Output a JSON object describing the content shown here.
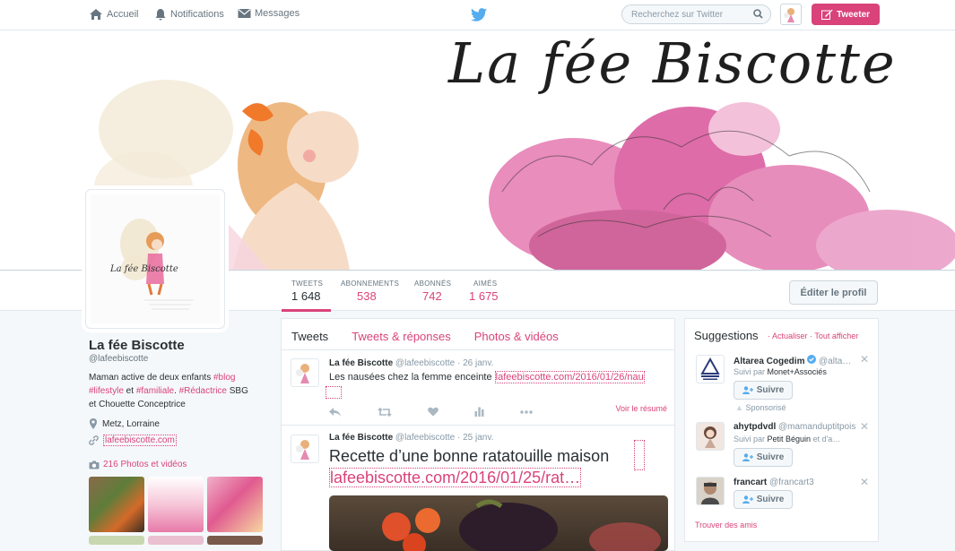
{
  "nav": {
    "home": "Accueil",
    "notifications": "Notifications",
    "messages": "Messages"
  },
  "search": {
    "placeholder": "Recherchez sur Twitter"
  },
  "tweet_button": "Tweeter",
  "banner": {
    "title": "La fée Biscotte"
  },
  "profile_pic": {
    "title": "La fée Biscotte"
  },
  "stats": [
    {
      "label": "TWEETS",
      "value": "1 648"
    },
    {
      "label": "ABONNEMENTS",
      "value": "538"
    },
    {
      "label": "ABONNÉS",
      "value": "742"
    },
    {
      "label": "AIMÉS",
      "value": "1 675"
    }
  ],
  "edit_profile": "Éditer le profil",
  "profile": {
    "name": "La fée Biscotte",
    "handle": "@lafeebiscotte",
    "bio_1": "Maman active de deux enfants ",
    "tag_blog": "#blog",
    "tag_lifestyle": "#lifestyle",
    "bio_et": " et ",
    "tag_familiale": "#familiale",
    "bio_dot": ". ",
    "tag_redactrice": "#Rédactrice",
    "bio_2": " SBG",
    "bio_3": "et Chouette Conceptrice",
    "location": "Metz, Lorraine",
    "website": "lafeebiscotte.com",
    "photos": "216 Photos et vidéos"
  },
  "tabs": [
    "Tweets",
    "Tweets & réponses",
    "Photos & vidéos"
  ],
  "tweets": [
    {
      "name": "La fée Biscotte",
      "handle": "@lafeebiscotte",
      "date": "· 26 janv.",
      "text": "Les nausées chez la femme enceinte ",
      "link": "lafeebiscotte.com/2016/01/26/nau",
      "more": "Voir le résumé"
    },
    {
      "name": "La fée Biscotte",
      "handle": "@lafeebiscotte",
      "date": "· 25 janv.",
      "text": "Recette d’une bonne ratatouille maison",
      "link": "lafeebiscotte.com/2016/01/25/rat…"
    }
  ],
  "suggestions": {
    "title": "Suggestions",
    "actions": "· Actualiser · Tout afficher",
    "follow_label": "Suivre",
    "items": [
      {
        "name": "Altarea Cogedim",
        "handle": "@alta…",
        "followed_prefix": "Suivi par ",
        "followed_by": "Monet+Associés",
        "sponsored": "Sponsorisé"
      },
      {
        "name": "ahytpdvdl",
        "handle": "@mamanduptitpois",
        "followed_prefix": "Suivi par ",
        "followed_by": "Petit Béguin",
        "followed_suffix": " et d'a…"
      },
      {
        "name": "francart",
        "handle": "@francart3"
      }
    ],
    "find_friends": "Trouver des amis"
  },
  "colors": {
    "accent": "#d9437a",
    "text": "#292f33",
    "muted": "#66757f"
  }
}
